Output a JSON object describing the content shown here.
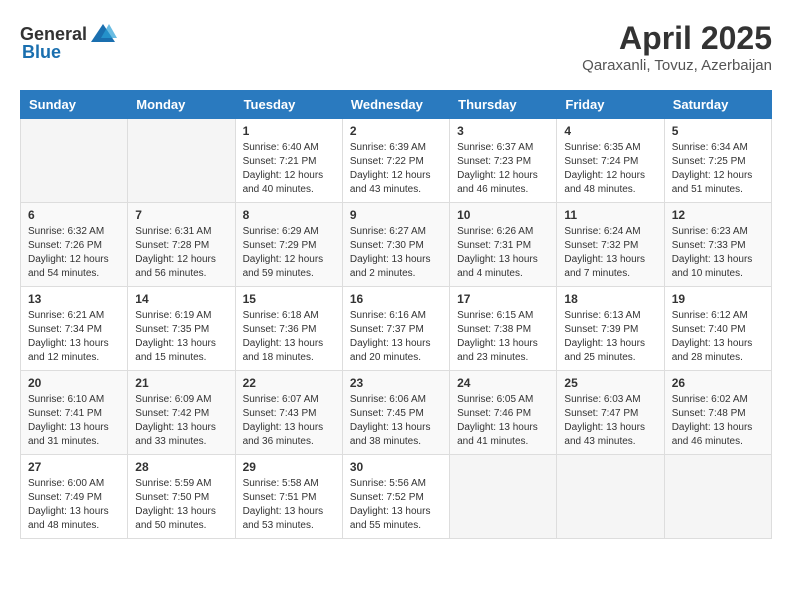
{
  "header": {
    "logo_general": "General",
    "logo_blue": "Blue",
    "month_year": "April 2025",
    "location": "Qaraxanli, Tovuz, Azerbaijan"
  },
  "weekdays": [
    "Sunday",
    "Monday",
    "Tuesday",
    "Wednesday",
    "Thursday",
    "Friday",
    "Saturday"
  ],
  "weeks": [
    [
      {
        "day": "",
        "info": ""
      },
      {
        "day": "",
        "info": ""
      },
      {
        "day": "1",
        "info": "Sunrise: 6:40 AM\nSunset: 7:21 PM\nDaylight: 12 hours\nand 40 minutes."
      },
      {
        "day": "2",
        "info": "Sunrise: 6:39 AM\nSunset: 7:22 PM\nDaylight: 12 hours\nand 43 minutes."
      },
      {
        "day": "3",
        "info": "Sunrise: 6:37 AM\nSunset: 7:23 PM\nDaylight: 12 hours\nand 46 minutes."
      },
      {
        "day": "4",
        "info": "Sunrise: 6:35 AM\nSunset: 7:24 PM\nDaylight: 12 hours\nand 48 minutes."
      },
      {
        "day": "5",
        "info": "Sunrise: 6:34 AM\nSunset: 7:25 PM\nDaylight: 12 hours\nand 51 minutes."
      }
    ],
    [
      {
        "day": "6",
        "info": "Sunrise: 6:32 AM\nSunset: 7:26 PM\nDaylight: 12 hours\nand 54 minutes."
      },
      {
        "day": "7",
        "info": "Sunrise: 6:31 AM\nSunset: 7:28 PM\nDaylight: 12 hours\nand 56 minutes."
      },
      {
        "day": "8",
        "info": "Sunrise: 6:29 AM\nSunset: 7:29 PM\nDaylight: 12 hours\nand 59 minutes."
      },
      {
        "day": "9",
        "info": "Sunrise: 6:27 AM\nSunset: 7:30 PM\nDaylight: 13 hours\nand 2 minutes."
      },
      {
        "day": "10",
        "info": "Sunrise: 6:26 AM\nSunset: 7:31 PM\nDaylight: 13 hours\nand 4 minutes."
      },
      {
        "day": "11",
        "info": "Sunrise: 6:24 AM\nSunset: 7:32 PM\nDaylight: 13 hours\nand 7 minutes."
      },
      {
        "day": "12",
        "info": "Sunrise: 6:23 AM\nSunset: 7:33 PM\nDaylight: 13 hours\nand 10 minutes."
      }
    ],
    [
      {
        "day": "13",
        "info": "Sunrise: 6:21 AM\nSunset: 7:34 PM\nDaylight: 13 hours\nand 12 minutes."
      },
      {
        "day": "14",
        "info": "Sunrise: 6:19 AM\nSunset: 7:35 PM\nDaylight: 13 hours\nand 15 minutes."
      },
      {
        "day": "15",
        "info": "Sunrise: 6:18 AM\nSunset: 7:36 PM\nDaylight: 13 hours\nand 18 minutes."
      },
      {
        "day": "16",
        "info": "Sunrise: 6:16 AM\nSunset: 7:37 PM\nDaylight: 13 hours\nand 20 minutes."
      },
      {
        "day": "17",
        "info": "Sunrise: 6:15 AM\nSunset: 7:38 PM\nDaylight: 13 hours\nand 23 minutes."
      },
      {
        "day": "18",
        "info": "Sunrise: 6:13 AM\nSunset: 7:39 PM\nDaylight: 13 hours\nand 25 minutes."
      },
      {
        "day": "19",
        "info": "Sunrise: 6:12 AM\nSunset: 7:40 PM\nDaylight: 13 hours\nand 28 minutes."
      }
    ],
    [
      {
        "day": "20",
        "info": "Sunrise: 6:10 AM\nSunset: 7:41 PM\nDaylight: 13 hours\nand 31 minutes."
      },
      {
        "day": "21",
        "info": "Sunrise: 6:09 AM\nSunset: 7:42 PM\nDaylight: 13 hours\nand 33 minutes."
      },
      {
        "day": "22",
        "info": "Sunrise: 6:07 AM\nSunset: 7:43 PM\nDaylight: 13 hours\nand 36 minutes."
      },
      {
        "day": "23",
        "info": "Sunrise: 6:06 AM\nSunset: 7:45 PM\nDaylight: 13 hours\nand 38 minutes."
      },
      {
        "day": "24",
        "info": "Sunrise: 6:05 AM\nSunset: 7:46 PM\nDaylight: 13 hours\nand 41 minutes."
      },
      {
        "day": "25",
        "info": "Sunrise: 6:03 AM\nSunset: 7:47 PM\nDaylight: 13 hours\nand 43 minutes."
      },
      {
        "day": "26",
        "info": "Sunrise: 6:02 AM\nSunset: 7:48 PM\nDaylight: 13 hours\nand 46 minutes."
      }
    ],
    [
      {
        "day": "27",
        "info": "Sunrise: 6:00 AM\nSunset: 7:49 PM\nDaylight: 13 hours\nand 48 minutes."
      },
      {
        "day": "28",
        "info": "Sunrise: 5:59 AM\nSunset: 7:50 PM\nDaylight: 13 hours\nand 50 minutes."
      },
      {
        "day": "29",
        "info": "Sunrise: 5:58 AM\nSunset: 7:51 PM\nDaylight: 13 hours\nand 53 minutes."
      },
      {
        "day": "30",
        "info": "Sunrise: 5:56 AM\nSunset: 7:52 PM\nDaylight: 13 hours\nand 55 minutes."
      },
      {
        "day": "",
        "info": ""
      },
      {
        "day": "",
        "info": ""
      },
      {
        "day": "",
        "info": ""
      }
    ]
  ]
}
